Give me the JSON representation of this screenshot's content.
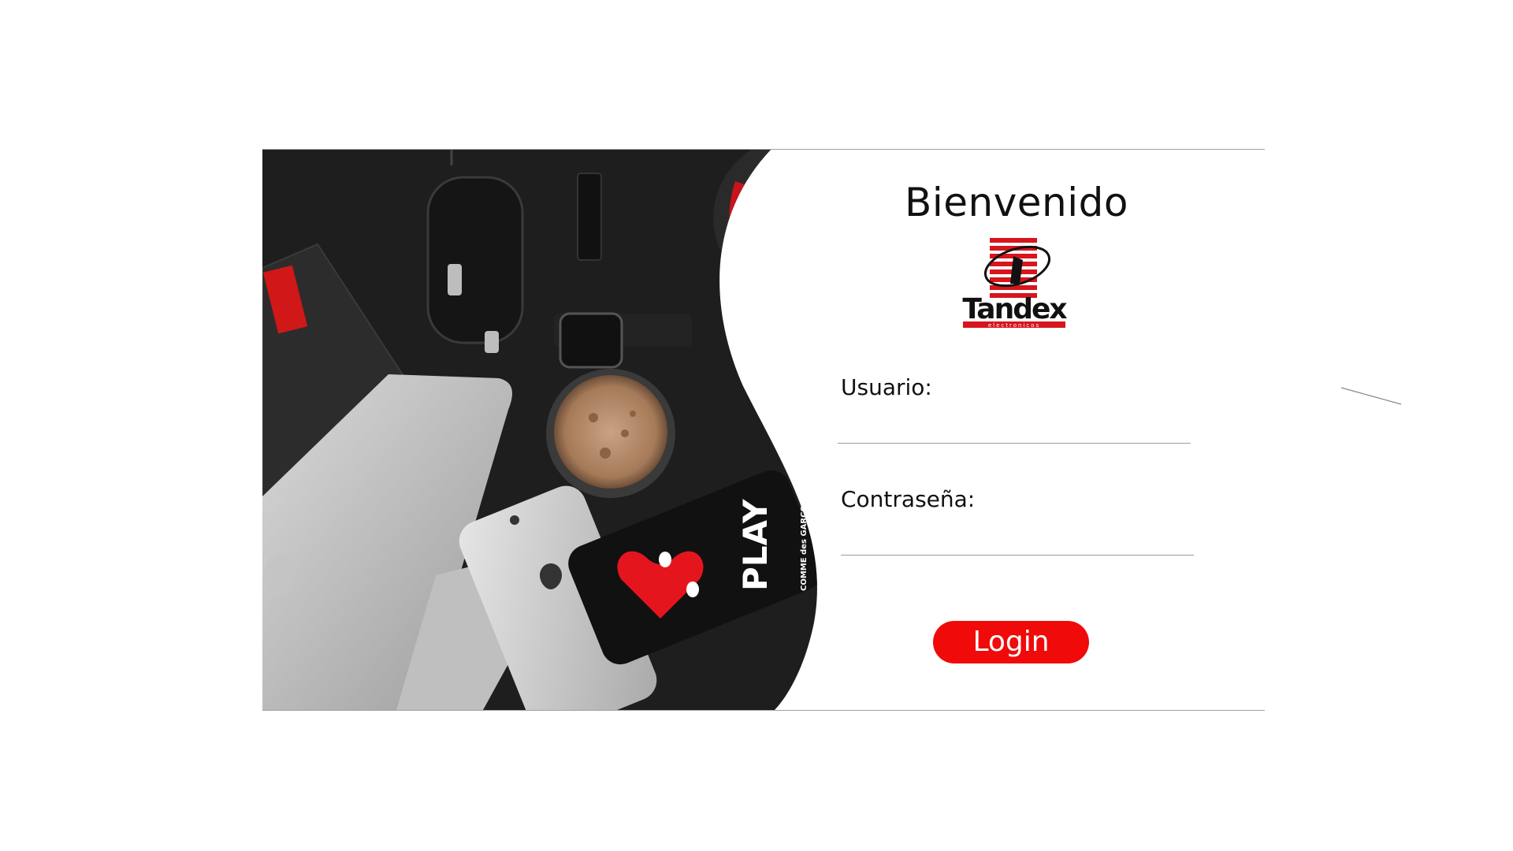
{
  "login": {
    "title": "Bienvenido",
    "username_label": "Usuario:",
    "username_value": "",
    "password_label": "Contraseña:",
    "password_value": "",
    "login_button": "Login"
  },
  "logo": {
    "brand": "Tandex",
    "tagline": "electronicos"
  },
  "photo": {
    "phone_case_text": "PLAY",
    "phone_case_subtext": "COMME des GARCONS"
  },
  "colors": {
    "accent": "#f00a0a",
    "photo_background": "#1e1e1e",
    "divider": "#a0a0a0"
  }
}
